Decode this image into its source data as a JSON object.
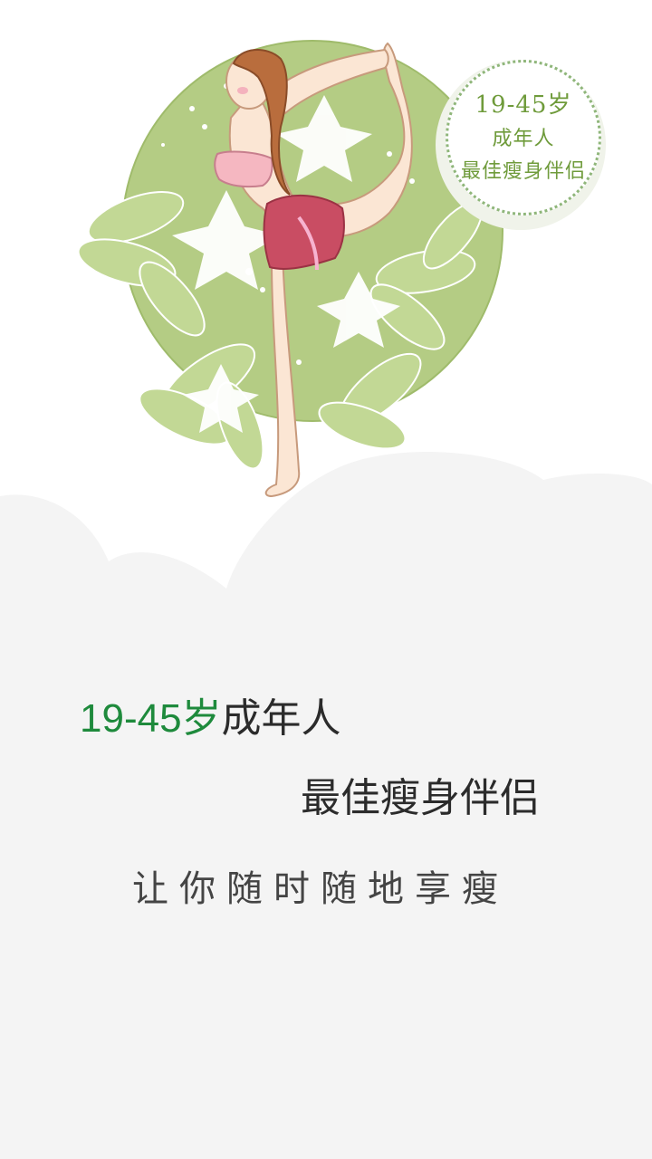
{
  "badge": {
    "line1": "19-45岁",
    "line2": "成年人",
    "line3": "最佳瘦身伴侣"
  },
  "headline": {
    "age": "19-45岁",
    "adult": "成年人"
  },
  "subhead": "最佳瘦身伴侣",
  "tagline": "让你随时随地享瘦",
  "colors": {
    "accent_green": "#1e8a3c",
    "circle_green": "#a9c57a",
    "cloud_gray": "#f5f5f5",
    "text_dark": "#2b2b2b"
  }
}
